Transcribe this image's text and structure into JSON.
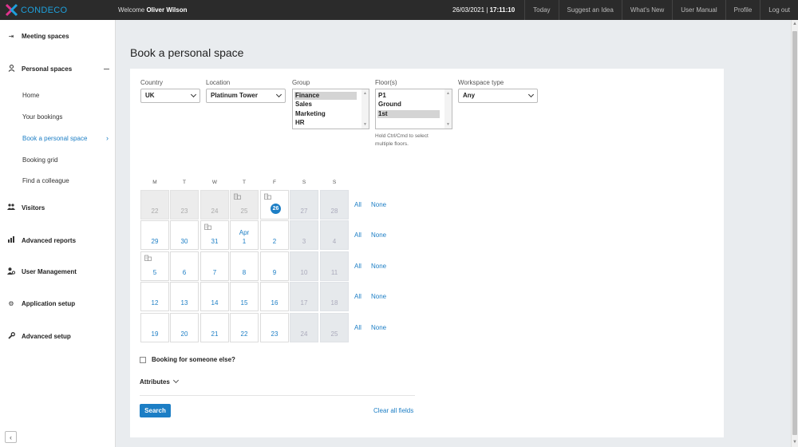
{
  "app": {
    "brand": "CONDECO",
    "accent": "#1c7ec5"
  },
  "topbar": {
    "welcome_prefix": "Welcome",
    "user_name": "Oliver Wilson",
    "date": "26/03/2021",
    "separator": "|",
    "time": "17:11:10",
    "links": [
      "Today",
      "Suggest an Idea",
      "What's New",
      "User Manual",
      "Profile",
      "Log out"
    ]
  },
  "sidebar": {
    "items": [
      {
        "label": "Meeting spaces",
        "icon": "meeting-icon"
      },
      {
        "label": "Personal spaces",
        "icon": "person-icon"
      },
      {
        "label": "Visitors",
        "icon": "visitors-icon"
      },
      {
        "label": "Advanced reports",
        "icon": "chart-icon"
      },
      {
        "label": "User Management",
        "icon": "user-gear-icon"
      },
      {
        "label": "Application setup",
        "icon": "gear-icon"
      },
      {
        "label": "Advanced setup",
        "icon": "wrench-icon"
      }
    ],
    "sub_items": [
      "Home",
      "Your bookings",
      "Book a personal space",
      "Booking grid",
      "Find a colleague"
    ]
  },
  "page": {
    "title": "Book a personal space"
  },
  "form": {
    "country": {
      "label": "Country",
      "value": "UK"
    },
    "location": {
      "label": "Location",
      "value": "Platinum Tower"
    },
    "group": {
      "label": "Group",
      "options": [
        "Finance",
        "Sales",
        "Marketing",
        "HR"
      ],
      "selected": "Finance"
    },
    "floors": {
      "label": "Floor(s)",
      "options": [
        "P1",
        "Ground",
        "1st"
      ],
      "selected": "1st",
      "hint_line1": "Hold Ctrl/Cmd to select",
      "hint_line2": "multiple floors."
    },
    "workspace_type": {
      "label": "Workspace type",
      "value": "Any"
    }
  },
  "calendar": {
    "weekdays": [
      "M",
      "T",
      "W",
      "T",
      "F",
      "S",
      "S"
    ],
    "today": "26",
    "weeks": [
      [
        "22",
        "23",
        "24",
        "25",
        "26",
        "27",
        "28"
      ],
      [
        "29",
        "30",
        "31",
        "1",
        "2",
        "3",
        "4"
      ],
      [
        "5",
        "6",
        "7",
        "8",
        "9",
        "10",
        "11"
      ],
      [
        "12",
        "13",
        "14",
        "15",
        "16",
        "17",
        "18"
      ],
      [
        "19",
        "20",
        "21",
        "22",
        "23",
        "24",
        "25"
      ]
    ],
    "month_label": "Apr",
    "row_all": "All",
    "row_none": "None"
  },
  "booking_for_other": {
    "label": "Booking for someone else?",
    "checked": false
  },
  "attributes": {
    "label": "Attributes"
  },
  "actions": {
    "search": "Search",
    "clear": "Clear all fields"
  }
}
